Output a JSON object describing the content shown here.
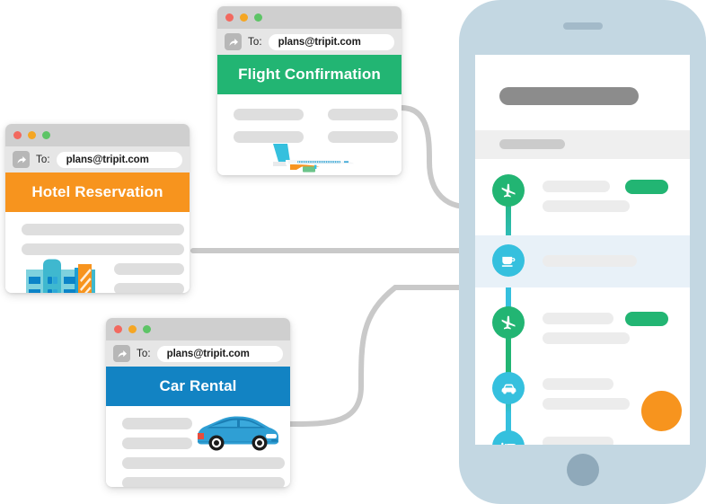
{
  "scene": {
    "title": "TripIt email forwarding to itinerary",
    "colors": {
      "flight_green": "#22b573",
      "hotel_orange": "#f7941e",
      "car_blue": "#1283c3",
      "timeline_cyan": "#35c0de",
      "phone_body": "#c3d7e2",
      "connector_gray": "#c9c9c9",
      "fab_orange": "#f7941e"
    }
  },
  "windows": [
    {
      "id": "hotel",
      "name": "hotel-reservation-window",
      "to_label": "To:",
      "recipient": "plans@tripit.com",
      "recipient_placeholder": "plans@tripit.com",
      "banner_title": "Hotel Reservation",
      "banner_color": "#f7941e",
      "forward_icon": "forward-arrow-icon",
      "illustration": "hotel-building-illustration",
      "traffic_lights": [
        "close-button",
        "minimize-button",
        "zoom-button"
      ]
    },
    {
      "id": "flight",
      "name": "flight-confirmation-window",
      "to_label": "To:",
      "recipient": "plans@tripit.com",
      "recipient_placeholder": "plans@tripit.com",
      "banner_title": "Flight Confirmation",
      "banner_color": "#22b573",
      "forward_icon": "forward-arrow-icon",
      "illustration": "airplane-illustration",
      "traffic_lights": [
        "close-button",
        "minimize-button",
        "zoom-button"
      ]
    },
    {
      "id": "car",
      "name": "car-rental-window",
      "to_label": "To:",
      "recipient": "plans@tripit.com",
      "recipient_placeholder": "plans@tripit.com",
      "banner_title": "Car Rental",
      "banner_color": "#1283c3",
      "forward_icon": "forward-arrow-icon",
      "illustration": "car-illustration",
      "traffic_lights": [
        "close-button",
        "minimize-button",
        "zoom-button"
      ]
    }
  ],
  "phone": {
    "name": "phone-mockup",
    "speaker": "earpiece-speaker",
    "home_button": "home-button",
    "screen": {
      "header_placeholder": "trip-title-placeholder",
      "subheader_placeholder": "trip-date-placeholder",
      "fab": "add-plan-fab",
      "timeline": [
        {
          "icon": "airplane-icon",
          "icon_color": "#22b573",
          "highlighted": false,
          "lines": 2,
          "badge": true
        },
        {
          "icon": "coffee-cup-icon",
          "icon_color": "#35c0de",
          "highlighted": true,
          "lines": 1,
          "badge": false
        },
        {
          "icon": "airplane-icon",
          "icon_color": "#22b573",
          "highlighted": false,
          "lines": 2,
          "badge": true
        },
        {
          "icon": "car-icon",
          "icon_color": "#35c0de",
          "highlighted": false,
          "lines": 2,
          "badge": false
        },
        {
          "icon": "bed-icon",
          "icon_color": "#35c0de",
          "highlighted": false,
          "lines": 1,
          "badge": false
        }
      ]
    }
  },
  "connectors": [
    {
      "name": "flight-to-phone-connector"
    },
    {
      "name": "hotel-to-phone-connector"
    },
    {
      "name": "car-to-phone-connector"
    }
  ]
}
